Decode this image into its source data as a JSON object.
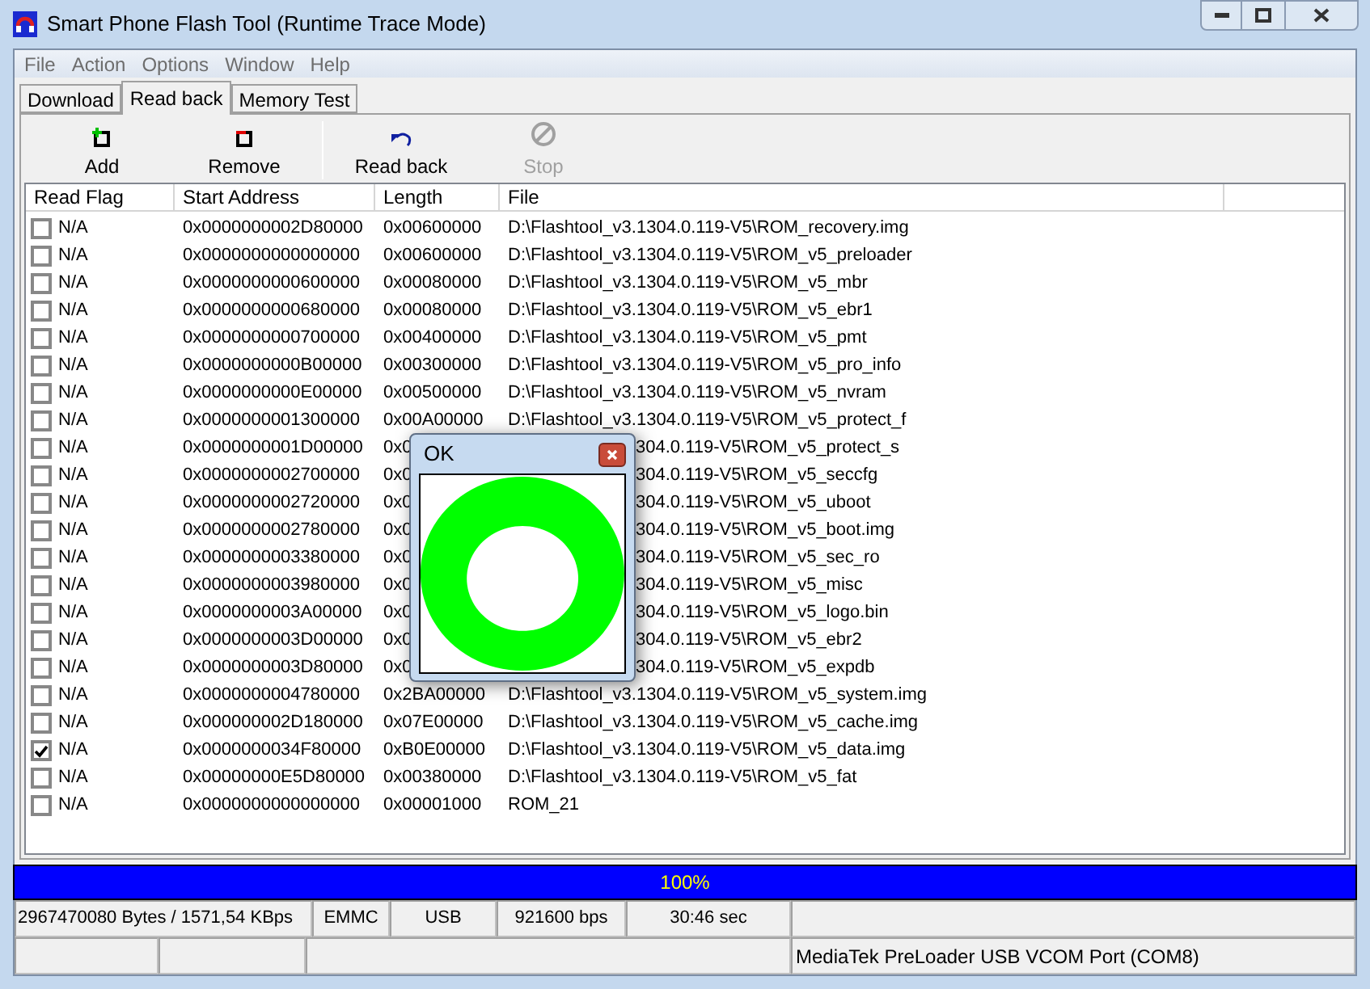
{
  "window": {
    "title": "Smart Phone Flash Tool (Runtime Trace Mode)"
  },
  "menu": [
    "File",
    "Action",
    "Options",
    "Window",
    "Help"
  ],
  "tabs": [
    {
      "label": "Download",
      "selected": false
    },
    {
      "label": "Read back",
      "selected": true
    },
    {
      "label": "Memory Test",
      "selected": false
    }
  ],
  "toolbar": [
    {
      "kind": "add",
      "label": "Add",
      "disabled": false
    },
    {
      "kind": "remove",
      "label": "Remove",
      "disabled": false
    },
    {
      "kind": "separator"
    },
    {
      "kind": "readback",
      "label": "Read back",
      "disabled": false
    },
    {
      "kind": "stop",
      "label": "Stop",
      "disabled": true
    }
  ],
  "table": {
    "columns": [
      "Read Flag",
      "Start Address",
      "Length",
      "File"
    ],
    "rows": [
      {
        "checked": false,
        "flag": "N/A",
        "start": "0x0000000002D80000",
        "length": "0x00600000",
        "file": "D:\\Flashtool_v3.1304.0.119-V5\\ROM_recovery.img"
      },
      {
        "checked": false,
        "flag": "N/A",
        "start": "0x0000000000000000",
        "length": "0x00600000",
        "file": "D:\\Flashtool_v3.1304.0.119-V5\\ROM_v5_preloader"
      },
      {
        "checked": false,
        "flag": "N/A",
        "start": "0x0000000000600000",
        "length": "0x00080000",
        "file": "D:\\Flashtool_v3.1304.0.119-V5\\ROM_v5_mbr"
      },
      {
        "checked": false,
        "flag": "N/A",
        "start": "0x0000000000680000",
        "length": "0x00080000",
        "file": "D:\\Flashtool_v3.1304.0.119-V5\\ROM_v5_ebr1"
      },
      {
        "checked": false,
        "flag": "N/A",
        "start": "0x0000000000700000",
        "length": "0x00400000",
        "file": "D:\\Flashtool_v3.1304.0.119-V5\\ROM_v5_pmt"
      },
      {
        "checked": false,
        "flag": "N/A",
        "start": "0x0000000000B00000",
        "length": "0x00300000",
        "file": "D:\\Flashtool_v3.1304.0.119-V5\\ROM_v5_pro_info"
      },
      {
        "checked": false,
        "flag": "N/A",
        "start": "0x0000000000E00000",
        "length": "0x00500000",
        "file": "D:\\Flashtool_v3.1304.0.119-V5\\ROM_v5_nvram"
      },
      {
        "checked": false,
        "flag": "N/A",
        "start": "0x0000000001300000",
        "length": "0x00A00000",
        "file": "D:\\Flashtool_v3.1304.0.119-V5\\ROM_v5_protect_f"
      },
      {
        "checked": false,
        "flag": "N/A",
        "start": "0x0000000001D00000",
        "length": "0x0",
        "file_end": "304.0.119-V5\\ROM_v5_protect_s"
      },
      {
        "checked": false,
        "flag": "N/A",
        "start": "0x0000000002700000",
        "length": "0x0",
        "file_end": "304.0.119-V5\\ROM_v5_seccfg"
      },
      {
        "checked": false,
        "flag": "N/A",
        "start": "0x0000000002720000",
        "length": "0x0",
        "file_end": "304.0.119-V5\\ROM_v5_uboot"
      },
      {
        "checked": false,
        "flag": "N/A",
        "start": "0x0000000002780000",
        "length": "0x0",
        "file_end": "304.0.119-V5\\ROM_v5_boot.img"
      },
      {
        "checked": false,
        "flag": "N/A",
        "start": "0x0000000003380000",
        "length": "0x0",
        "file_end": "304.0.119-V5\\ROM_v5_sec_ro"
      },
      {
        "checked": false,
        "flag": "N/A",
        "start": "0x0000000003980000",
        "length": "0x0",
        "file_end": "304.0.119-V5\\ROM_v5_misc"
      },
      {
        "checked": false,
        "flag": "N/A",
        "start": "0x0000000003A00000",
        "length": "0x0",
        "file_end": "304.0.119-V5\\ROM_v5_logo.bin"
      },
      {
        "checked": false,
        "flag": "N/A",
        "start": "0x0000000003D00000",
        "length": "0x0",
        "file_end": "304.0.119-V5\\ROM_v5_ebr2"
      },
      {
        "checked": false,
        "flag": "N/A",
        "start": "0x0000000003D80000",
        "length": "0x0",
        "file_end": "304.0.119-V5\\ROM_v5_expdb"
      },
      {
        "checked": false,
        "flag": "N/A",
        "start": "0x0000000004780000",
        "length": "0x2BA00000",
        "file": "D:\\Flashtool_v3.1304.0.119-V5\\ROM_v5_system.img"
      },
      {
        "checked": false,
        "flag": "N/A",
        "start": "0x000000002D180000",
        "length": "0x07E00000",
        "file": "D:\\Flashtool_v3.1304.0.119-V5\\ROM_v5_cache.img"
      },
      {
        "checked": true,
        "flag": "N/A",
        "start": "0x0000000034F80000",
        "length": "0xB0E00000",
        "file": "D:\\Flashtool_v3.1304.0.119-V5\\ROM_v5_data.img"
      },
      {
        "checked": false,
        "flag": "N/A",
        "start": "0x00000000E5D80000",
        "length": "0x00380000",
        "file": "D:\\Flashtool_v3.1304.0.119-V5\\ROM_v5_fat"
      },
      {
        "checked": false,
        "flag": "N/A",
        "start": "0x0000000000000000",
        "length": "0x00001000",
        "file": "ROM_21"
      }
    ]
  },
  "progress": {
    "level": 1,
    "text": "100%"
  },
  "status_bar": {
    "row_1": [
      "2967470080 Bytes / 1571,54 KBps",
      "EMMC",
      "USB",
      "921600 bps",
      "30:46 sec"
    ],
    "row_2": [
      "MediaTek PreLoader USB VCOM Port (COM8)"
    ]
  },
  "dialog": {
    "title": "OK"
  }
}
